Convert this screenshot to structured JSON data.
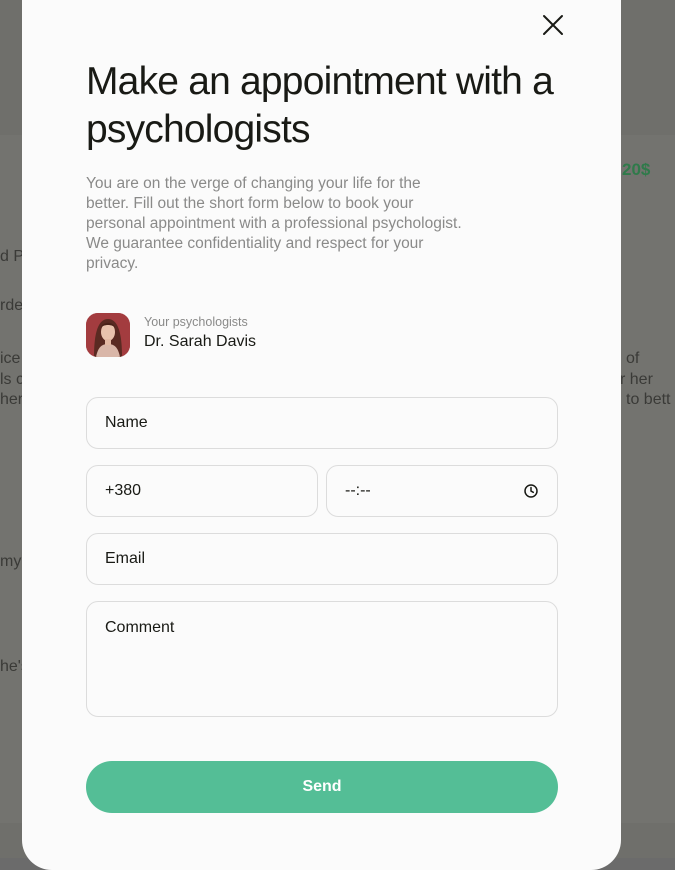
{
  "background": {
    "fragments": [
      "d P",
      "rde",
      "ice",
      "ls c",
      "her",
      "my",
      "he's",
      "of",
      "r her",
      "to bett"
    ],
    "price_fragment": "20$"
  },
  "modal": {
    "close_icon": "close-icon",
    "title": "Make an appointment with a psychologists",
    "description": "You are on the verge of changing your life for the better. Fill out the short form below to book your personal appointment with a professional psychologist. We guarantee confidentiality and respect for your privacy.",
    "psychologist": {
      "caption": "Your psychologists",
      "name": "Dr. Sarah Davis"
    },
    "form": {
      "name_placeholder": "Name",
      "phone_value": "+380",
      "time_value": "--:--",
      "email_placeholder": "Email",
      "comment_placeholder": "Comment",
      "send_label": "Send"
    }
  },
  "colors": {
    "accent": "#54be96",
    "title": "#191a15",
    "muted": "#8a8a89",
    "overlay": "#6f6f6b",
    "price": "#2f7a4a"
  }
}
